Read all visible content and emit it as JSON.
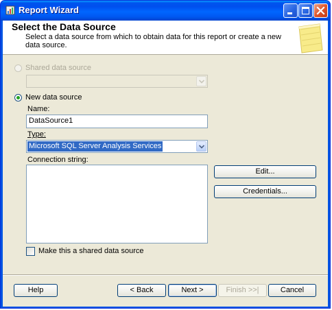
{
  "window": {
    "title": "Report Wizard",
    "controls": [
      "minimize-icon",
      "maximize-icon",
      "close-icon"
    ]
  },
  "header": {
    "title": "Select the Data Source",
    "description": "Select a data source from which to obtain data for this report or create a new data source."
  },
  "shared": {
    "radio_label": "Shared data source",
    "selected": false,
    "enabled": false,
    "dropdown_value": ""
  },
  "new_source": {
    "radio_label": "New data source",
    "selected": true,
    "name_label": "Name:",
    "name_value": "DataSource1",
    "type_label": "Type:",
    "type_value": "Microsoft SQL Server Analysis Services",
    "connection_label": "Connection string:",
    "connection_value": "",
    "edit_button": "Edit...",
    "credentials_button": "Credentials...",
    "make_shared_label": "Make this a shared data source",
    "make_shared_checked": false
  },
  "footer": {
    "help_button": "Help",
    "back_button": "< Back",
    "next_button": "Next >",
    "finish_button": "Finish >>|",
    "cancel_button": "Cancel"
  },
  "colors": {
    "titlebar": "#0054e3",
    "dialog_bg": "#ece9d8",
    "selection": "#316ac5",
    "radio_dot": "#21a121"
  }
}
